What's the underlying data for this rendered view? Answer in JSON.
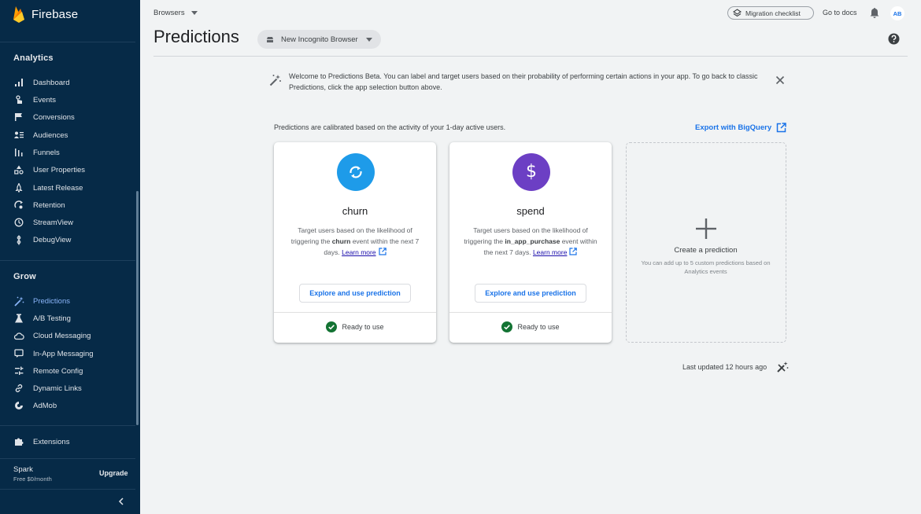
{
  "sidebar": {
    "brand": "Firebase",
    "analytics_title": "Analytics",
    "analytics_items": [
      {
        "label": "Dashboard",
        "icon": "bar-chart-icon"
      },
      {
        "label": "Events",
        "icon": "touch-icon"
      },
      {
        "label": "Conversions",
        "icon": "flag-icon"
      },
      {
        "label": "Audiences",
        "icon": "audience-icon"
      },
      {
        "label": "Funnels",
        "icon": "funnel-icon"
      },
      {
        "label": "User Properties",
        "icon": "shapes-icon"
      },
      {
        "label": "Latest Release",
        "icon": "release-icon"
      },
      {
        "label": "Retention",
        "icon": "retention-icon"
      },
      {
        "label": "StreamView",
        "icon": "clock-icon"
      },
      {
        "label": "DebugView",
        "icon": "debug-icon"
      }
    ],
    "grow_title": "Grow",
    "grow_items": [
      {
        "label": "Predictions",
        "icon": "magic-wand-icon",
        "active": true
      },
      {
        "label": "A/B Testing",
        "icon": "flask-icon"
      },
      {
        "label": "Cloud Messaging",
        "icon": "cloud-icon"
      },
      {
        "label": "In-App Messaging",
        "icon": "chat-icon"
      },
      {
        "label": "Remote Config",
        "icon": "remote-config-icon"
      },
      {
        "label": "Dynamic Links",
        "icon": "link-icon"
      },
      {
        "label": "AdMob",
        "icon": "admob-icon"
      }
    ],
    "extensions": "Extensions",
    "plan_name": "Spark",
    "plan_price": "Free $0/month",
    "upgrade": "Upgrade"
  },
  "header": {
    "breadcrumb": "Browsers",
    "migration": "Migration checklist",
    "docs": "Go to docs",
    "avatar": "AB",
    "title": "Predictions",
    "app_selector": "New Incognito Browser"
  },
  "banner": {
    "text": "Welcome to Predictions Beta. You can label and target users based on their probability of performing certain actions in your app. To go back to classic Predictions, click the app selection button above."
  },
  "calibration": "Predictions are calibrated based on the activity of your 1-day active users.",
  "export": "Export with BigQuery",
  "cards": [
    {
      "title": "churn",
      "desc_pre": "Target users based on the likelihood of triggering the ",
      "event": "churn",
      "desc_post": " event within the next 7 days. ",
      "learn": "Learn more",
      "button": "Explore and use prediction",
      "status": "Ready to use",
      "icon_color": "#1e9be9"
    },
    {
      "title": "spend",
      "desc_pre": "Target users based on the likelihood of triggering the ",
      "event": "in_app_purchase",
      "desc_post": " event within the next 7 days. ",
      "learn": "Learn more",
      "button": "Explore and use prediction",
      "status": "Ready to use",
      "icon_color": "#6c3fc4"
    }
  ],
  "create": {
    "title": "Create a prediction",
    "subtitle": "You can add up to 5 custom predictions based on Analytics events"
  },
  "last_updated": "Last updated 12 hours ago",
  "colors": {
    "sidebar_bg": "#062a47",
    "accent": "#1a73e8",
    "active": "#8ab4f8",
    "ready": "#137333"
  }
}
